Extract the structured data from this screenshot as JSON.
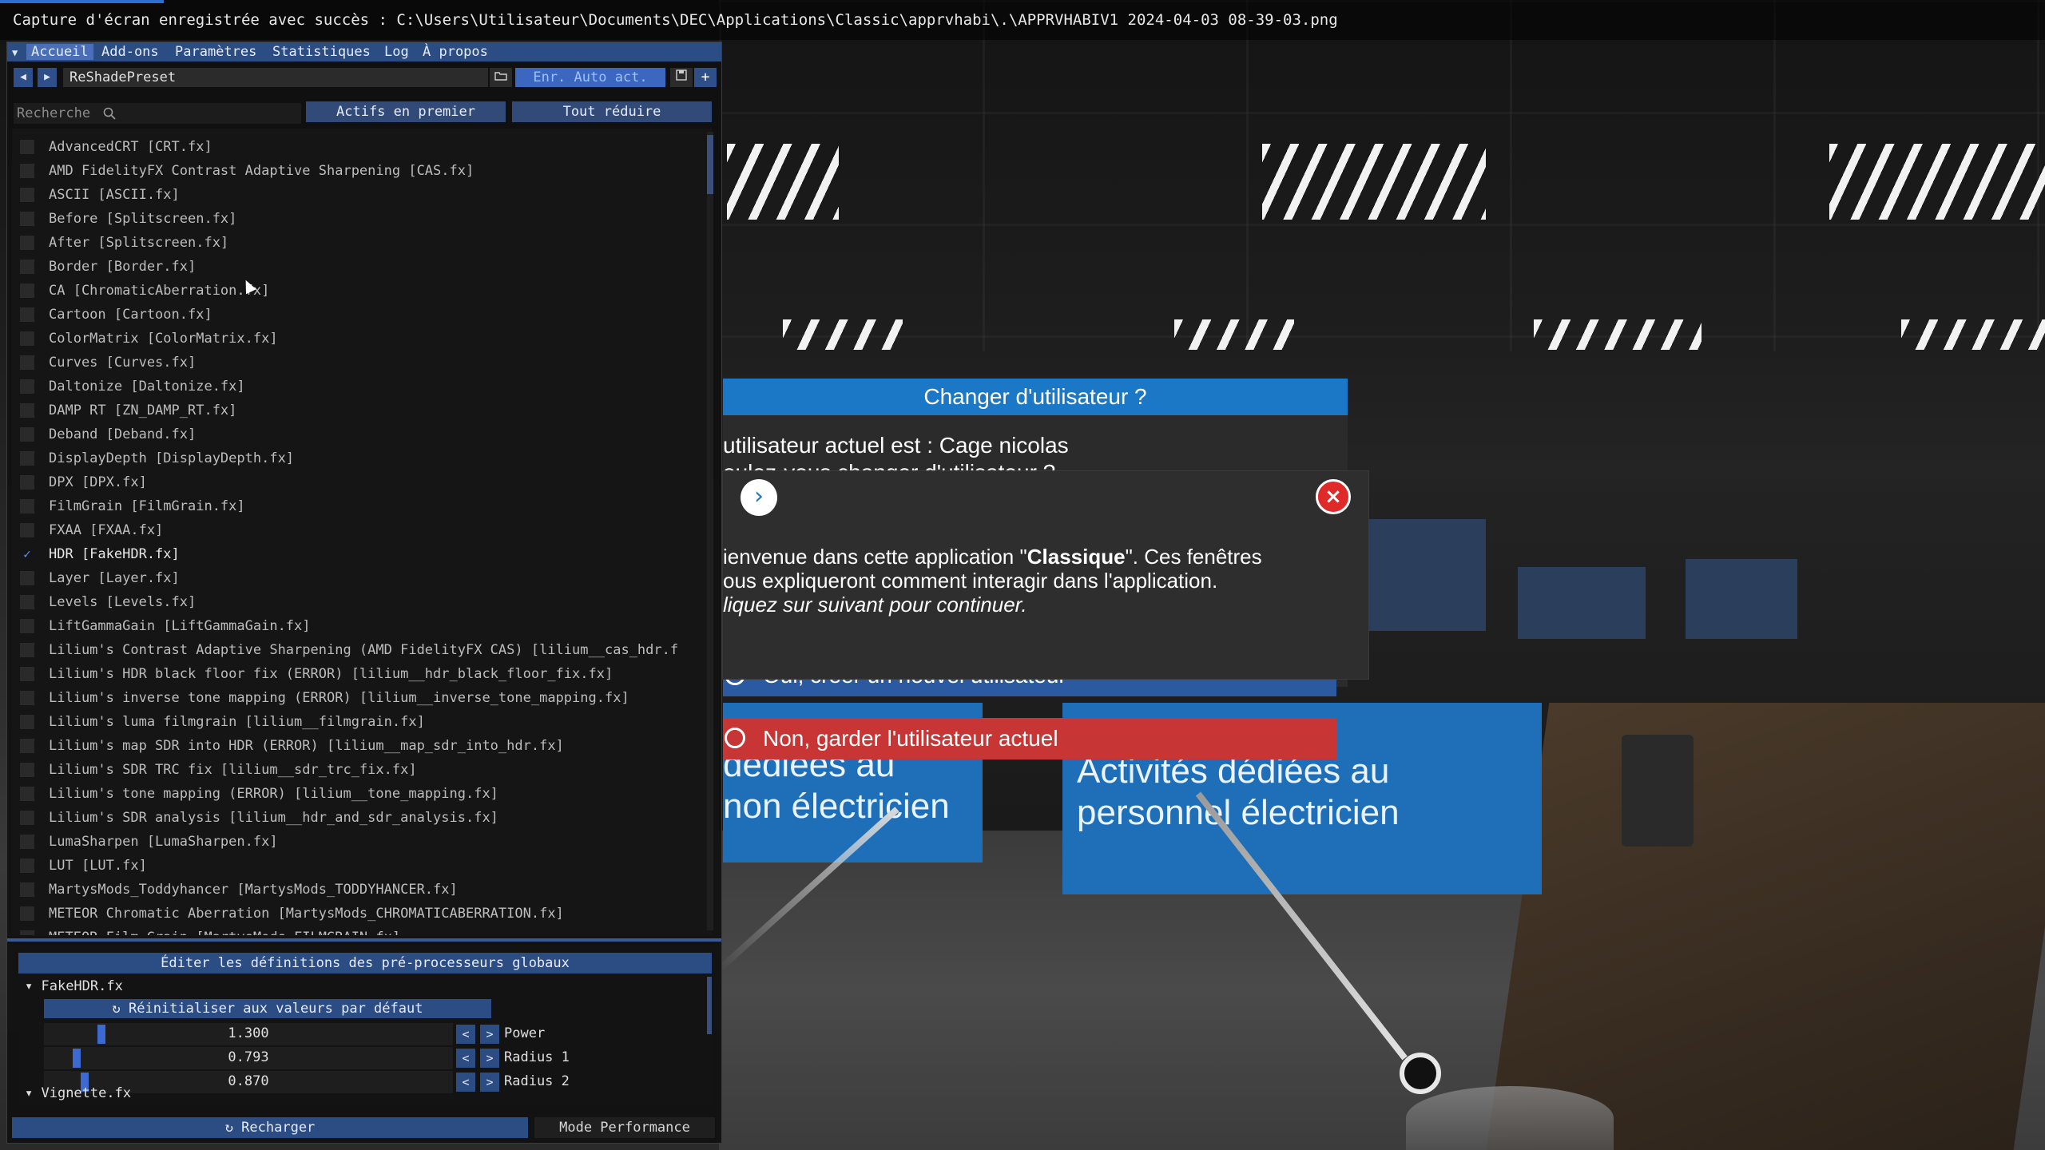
{
  "status_bar": {
    "message": "Capture d'écran enregistrée avec succès : C:\\Users\\Utilisateur\\Documents\\DEC\\Applications\\Classic\\apprvhabi\\.\\APPRVHABIV1 2024-04-03 08-39-03.png"
  },
  "menu": {
    "items": [
      "Accueil",
      "Add-ons",
      "Paramètres",
      "Statistiques",
      "Log",
      "À propos"
    ]
  },
  "preset_bar": {
    "prev_icon": "◀",
    "next_icon": "▶",
    "preset_name": "ReShadePreset",
    "folder_icon": "folder-icon",
    "autosave_label": "Enr. Auto act.",
    "save_icon": "save-icon",
    "add_icon": "+"
  },
  "search": {
    "placeholder": "Recherche"
  },
  "buttons": {
    "active_first": "Actifs en premier",
    "collapse_all": "Tout réduire",
    "reload": "Recharger",
    "performance_mode": "Mode Performance",
    "reset_defaults": "Réinitialiser aux valeurs par défaut"
  },
  "effects": [
    {
      "name": "AdvancedCRT [CRT.fx]",
      "enabled": false
    },
    {
      "name": "AMD FidelityFX Contrast Adaptive Sharpening [CAS.fx]",
      "enabled": false
    },
    {
      "name": "ASCII [ASCII.fx]",
      "enabled": false
    },
    {
      "name": "Before [Splitscreen.fx]",
      "enabled": false
    },
    {
      "name": "After [Splitscreen.fx]",
      "enabled": false
    },
    {
      "name": "Border [Border.fx]",
      "enabled": false
    },
    {
      "name": "CA [ChromaticAberration.fx]",
      "enabled": false
    },
    {
      "name": "Cartoon [Cartoon.fx]",
      "enabled": false
    },
    {
      "name": "ColorMatrix [ColorMatrix.fx]",
      "enabled": false
    },
    {
      "name": "Curves [Curves.fx]",
      "enabled": false
    },
    {
      "name": "Daltonize [Daltonize.fx]",
      "enabled": false
    },
    {
      "name": "DAMP RT [ZN_DAMP_RT.fx]",
      "enabled": false
    },
    {
      "name": "Deband [Deband.fx]",
      "enabled": false
    },
    {
      "name": "DisplayDepth [DisplayDepth.fx]",
      "enabled": false
    },
    {
      "name": "DPX [DPX.fx]",
      "enabled": false
    },
    {
      "name": "FilmGrain [FilmGrain.fx]",
      "enabled": false
    },
    {
      "name": "FXAA [FXAA.fx]",
      "enabled": false
    },
    {
      "name": "HDR [FakeHDR.fx]",
      "enabled": true
    },
    {
      "name": "Layer [Layer.fx]",
      "enabled": false
    },
    {
      "name": "Levels [Levels.fx]",
      "enabled": false
    },
    {
      "name": "LiftGammaGain [LiftGammaGain.fx]",
      "enabled": false
    },
    {
      "name": "Lilium's Contrast Adaptive Sharpening (AMD FidelityFX CAS) [lilium__cas_hdr.f",
      "enabled": false
    },
    {
      "name": "Lilium's HDR black floor fix (ERROR) [lilium__hdr_black_floor_fix.fx]",
      "enabled": false
    },
    {
      "name": "Lilium's inverse tone mapping (ERROR) [lilium__inverse_tone_mapping.fx]",
      "enabled": false
    },
    {
      "name": "Lilium's luma filmgrain [lilium__filmgrain.fx]",
      "enabled": false
    },
    {
      "name": "Lilium's map SDR into HDR (ERROR) [lilium__map_sdr_into_hdr.fx]",
      "enabled": false
    },
    {
      "name": "Lilium's SDR TRC fix [lilium__sdr_trc_fix.fx]",
      "enabled": false
    },
    {
      "name": "Lilium's tone mapping (ERROR) [lilium__tone_mapping.fx]",
      "enabled": false
    },
    {
      "name": "Lilium's SDR analysis [lilium__hdr_and_sdr_analysis.fx]",
      "enabled": false
    },
    {
      "name": "LumaSharpen [LumaSharpen.fx]",
      "enabled": false
    },
    {
      "name": "LUT [LUT.fx]",
      "enabled": false
    },
    {
      "name": "MartysMods_Toddyhancer [MartysMods_TODDYHANCER.fx]",
      "enabled": false
    },
    {
      "name": "METEOR Chromatic Aberration [MartysMods_CHROMATICABERRATION.fx]",
      "enabled": false
    },
    {
      "name": "METEOR Film Grain [MartysMods_FILMGRAIN.fx]",
      "enabled": false
    }
  ],
  "settings_panel": {
    "header": "Éditer les définitions des pré-processeurs globaux",
    "group1": "FakeHDR.fx",
    "group2": "Vignette.fx",
    "params": [
      {
        "name": "Power",
        "value": "1.300",
        "fraction": 0.13
      },
      {
        "name": "Radius 1",
        "value": "0.793",
        "fraction": 0.07
      },
      {
        "name": "Radius 2",
        "value": "0.870",
        "fraction": 0.09
      }
    ]
  },
  "vr_ui": {
    "dialog_title": "Changer d'utilisateur ?",
    "current_user_line": "utilisateur actuel est : Cage nicolas",
    "question_line": "oulez-vous changer d'utilisateur ?",
    "btn_yes": "Oui, créer un nouvel utilisateur",
    "btn_no": "Non, garder l'utilisateur actuel",
    "tutorial": {
      "line1_prefix": "ienvenue dans cette application \"",
      "line1_bold": "Classique",
      "line1_suffix": "\". Ces fenêtres",
      "line2": "ous expliqueront comment interagir dans l'application.",
      "line3": "liquez sur suivant pour continuer.",
      "next_icon": "›",
      "close_icon": "×"
    },
    "panel_left_text": [
      "dédiées au",
      "non électricien"
    ],
    "panel_right_text": [
      "Activités dédiées au",
      "personnel électricien"
    ]
  },
  "colors": {
    "accent_blue": "#2c4c84",
    "vr_blue": "#1b78c7",
    "vr_red": "#c73535",
    "close_red": "#e02a2a"
  }
}
